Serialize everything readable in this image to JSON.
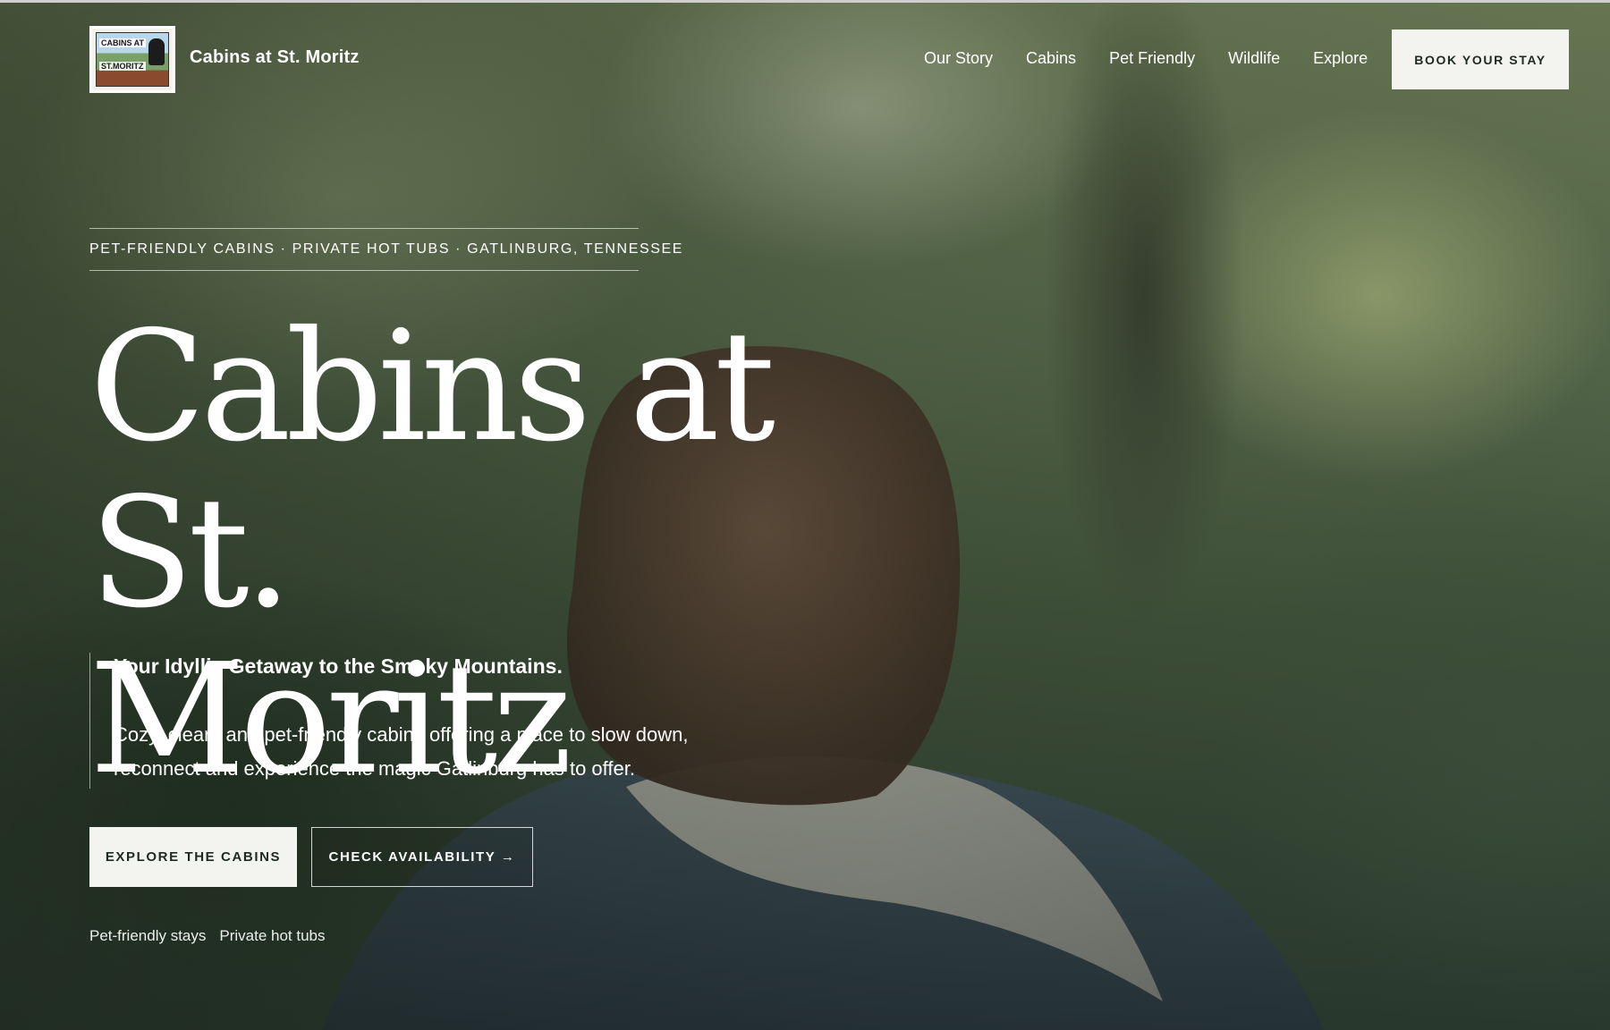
{
  "header": {
    "logo_text_line1": "CABINS AT",
    "logo_text_line2": "ST.MORITZ",
    "brand_name": "Cabins at St. Moritz",
    "nav": [
      {
        "label": "Our Story"
      },
      {
        "label": "Cabins"
      },
      {
        "label": "Pet Friendly"
      },
      {
        "label": "Wildlife"
      },
      {
        "label": "Explore"
      }
    ],
    "book_button": "BOOK YOUR STAY"
  },
  "hero": {
    "kicker": "PET-FRIENDLY CABINS · PRIVATE HOT TUBS · GATLINBURG, TENNESSEE",
    "headline_line1": "Cabins at St.",
    "headline_line2": "Moritz",
    "tagline": "Your Idyllic Getaway to the Smoky Mountains.",
    "description": "Cozy, clean, and pet-friendly cabins offering a place to slow down, reconnect and experience the magic Gatlinburg has to offer.",
    "primary_button": "EXPLORE THE CABINS",
    "secondary_button": "CHECK AVAILABILITY →",
    "features": [
      "Pet-friendly stays",
      "Private hot tubs"
    ]
  },
  "colors": {
    "button_bg": "#f3f3f0",
    "button_text": "#1f2a22",
    "text": "#ffffff"
  }
}
